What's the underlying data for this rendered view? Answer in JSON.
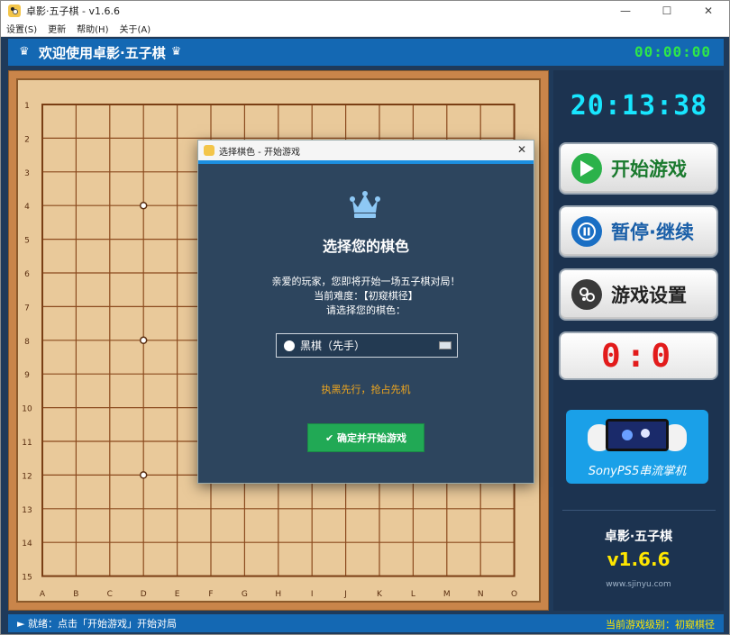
{
  "window": {
    "title": "卓影·五子棋 - v1.6.6",
    "minimize_glyph": "—",
    "maximize_glyph": "☐",
    "close_glyph": "✕"
  },
  "menu": [
    "设置(S)",
    "更新",
    "帮助(H)",
    "关于(A)"
  ],
  "header": {
    "title": "欢迎使用卓影·五子棋",
    "left_icon": "crown-icon",
    "right_icon": "crown-icon",
    "timer": "00:00:00"
  },
  "board": {
    "size": 15,
    "row_labels": [
      "1",
      "2",
      "3",
      "4",
      "5",
      "6",
      "7",
      "8",
      "9",
      "10",
      "11",
      "12",
      "13",
      "14",
      "15"
    ],
    "col_labels": [
      "A",
      "B",
      "C",
      "D",
      "E",
      "F",
      "G",
      "H",
      "I",
      "J",
      "K",
      "L",
      "M",
      "N",
      "O"
    ],
    "star_points": [
      [
        "D",
        4
      ],
      [
        "D",
        8
      ],
      [
        "D",
        12
      ]
    ]
  },
  "right_panel": {
    "clock": "20:13:38",
    "buttons": [
      {
        "label": "开始游戏",
        "icon": "play-icon",
        "color": "#1a7a2e"
      },
      {
        "label": "暂停·继续",
        "icon": "pause-icon",
        "color": "#1a5fa8"
      },
      {
        "label": "游戏设置",
        "icon": "settings-icon",
        "color": "#222222"
      }
    ],
    "score": {
      "black": "0",
      "separator": ":",
      "white": "0"
    },
    "ad_text": "SonyPS5串流掌机",
    "app_name": "卓影·五子棋",
    "app_version": "v1.6.6",
    "app_site": "www.sjinyu.com"
  },
  "status": {
    "left": "► 就绪：点击「开始游戏」开始对局",
    "right": "当前游戏级别：初窥棋径"
  },
  "dialog": {
    "title": "选择棋色 - 开始游戏",
    "close_glyph": "✕",
    "heading": "选择您的棋色",
    "line1": "亲爱的玩家，您即将开始一场五子棋对局！",
    "line2": "当前难度：【初窥棋径】",
    "line3": "请选择您的棋色：",
    "select_value": "黑棋（先手）",
    "hint": "执黑先行，抢占先机",
    "confirm_label": "✔ 确定并开始游戏"
  },
  "colors": {
    "accent_blue": "#1468b3",
    "timer_green": "#2ee64a",
    "clock_cyan": "#18e6ff",
    "score_red": "#e21b1b",
    "version_yellow": "#ffe600",
    "confirm_green": "#21a955"
  }
}
